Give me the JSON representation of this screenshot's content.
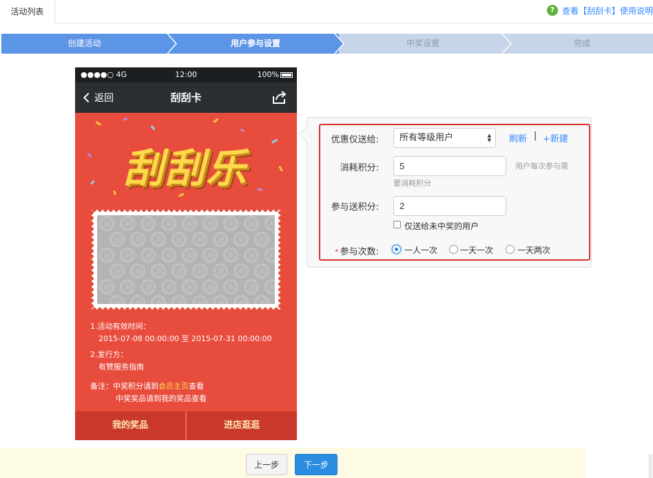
{
  "topbar": {
    "active_tab": "活动列表",
    "help_link": "查看【刮刮卡】使用说明"
  },
  "steps": [
    {
      "label": "创建活动",
      "state": "done"
    },
    {
      "label": "用户参与设置",
      "state": "current"
    },
    {
      "label": "中奖设置",
      "state": "todo"
    },
    {
      "label": "完成",
      "state": "todo"
    }
  ],
  "colors": {
    "step_active": "#5c95e6",
    "step_inactive": "#c7d5e8",
    "phone_bg": "#e84c3d",
    "highlight_border": "#d9302b",
    "primary_button": "#2b8de0"
  },
  "phone": {
    "status": {
      "carrier": "●●●●○ 4G",
      "time": "12:00",
      "battery": "100%"
    },
    "nav": {
      "back": "返回",
      "title": "刮刮卡",
      "share_icon": "share-icon"
    },
    "banner_text": "刮刮乐",
    "scratch_watermark": "刮",
    "info": {
      "validity_title": "1.活动有效时间：",
      "validity_range": "2015-07-08 00:00:00 至 2015-07-31 00:00:00",
      "issuer_title": "2.发行方：",
      "issuer_name": "有赞服务指南",
      "note_prefix": "备注：",
      "note_line1_a": "中奖积分请到",
      "note_line1_link": "会员主页",
      "note_line1_b": "查看",
      "note_line2": "中奖奖品请到我的奖品查看"
    },
    "footer": {
      "my_prizes": "我的奖品",
      "visit_store": "进店逛逛"
    }
  },
  "settings": {
    "send_to_label": "优惠仅送给:",
    "send_to_value": "所有等级用户",
    "refresh": "刷新",
    "separator": "|",
    "new": "+新建",
    "cost_label": "消耗积分:",
    "cost_value": "5",
    "cost_hint_right": "用户每次参与需",
    "cost_hint_below": "要消耗积分",
    "reward_label": "参与送积分:",
    "reward_value": "2",
    "reward_checkbox": "仅送给未中奖的用户",
    "times_required": "*",
    "times_label": "参与次数:",
    "times_options": [
      {
        "label": "一人一次",
        "selected": true
      },
      {
        "label": "一天一次",
        "selected": false
      },
      {
        "label": "一天两次",
        "selected": false
      }
    ]
  },
  "footer": {
    "prev": "上一步",
    "next": "下一步"
  }
}
